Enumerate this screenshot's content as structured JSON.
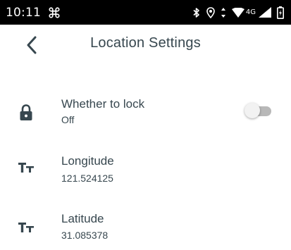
{
  "status_bar": {
    "time": "10:11",
    "app_icon": "command-icon",
    "network_label": "4G",
    "icons": [
      "bluetooth-icon",
      "location-icon",
      "data-arrows-icon",
      "wifi-icon",
      "signal-icon",
      "battery-icon"
    ]
  },
  "app_bar": {
    "title": "Location Settings",
    "back_icon": "chevron-left-icon"
  },
  "settings": {
    "items": [
      {
        "title": "Whether to lock",
        "subtitle": "Off",
        "icon": "lock-icon",
        "toggle_on": false
      },
      {
        "title": "Longitude",
        "subtitle": "121.524125",
        "icon": "text-size-icon"
      },
      {
        "title": "Latitude",
        "subtitle": "31.085378",
        "icon": "text-size-icon"
      }
    ]
  },
  "colors": {
    "status_bar_bg": "#000000",
    "text_primary": "#37474f",
    "toggle_track_off": "#b8b8b8",
    "toggle_thumb_off": "#f2f2f2"
  }
}
